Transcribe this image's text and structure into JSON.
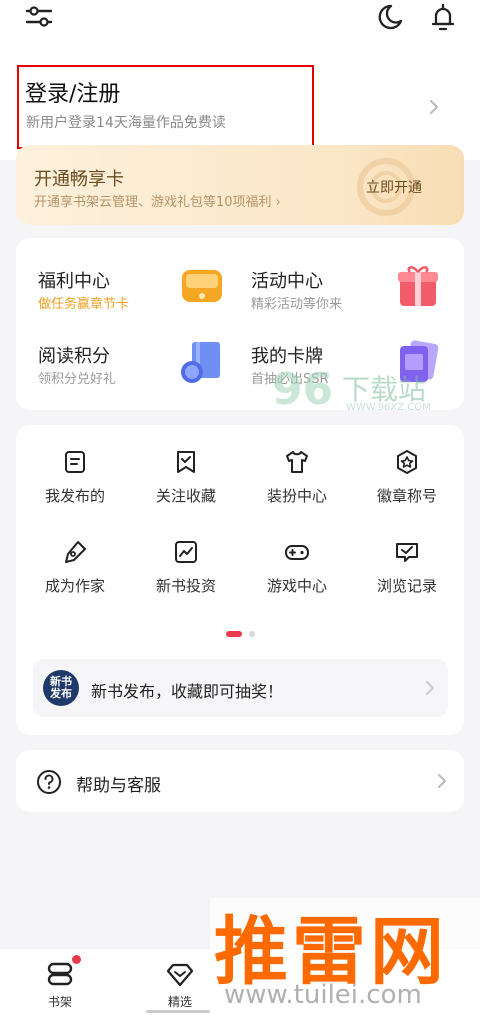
{
  "header": {
    "login_title": "登录/注册",
    "login_subtitle": "新用户登录14天海量作品免费读"
  },
  "vip": {
    "title": "开通畅享卡",
    "subtitle": "开通享书架云管理、游戏礼包等10项福利 ›",
    "cta": "立即开通"
  },
  "benefits": [
    {
      "title": "福利中心",
      "subtitle": "做任务赢章节卡",
      "icon": "coin-box-icon"
    },
    {
      "title": "活动中心",
      "subtitle": "精彩活动等你来",
      "icon": "gift-box-icon"
    },
    {
      "title": "阅读积分",
      "subtitle": "领积分兑好礼",
      "icon": "book-coin-icon"
    },
    {
      "title": "我的卡牌",
      "subtitle": "首抽必出SSR",
      "icon": "card-icon"
    }
  ],
  "grid": [
    {
      "label": "我发布的",
      "icon": "document-icon"
    },
    {
      "label": "关注收藏",
      "icon": "bookmark-check-icon"
    },
    {
      "label": "装扮中心",
      "icon": "shirt-icon"
    },
    {
      "label": "徽章称号",
      "icon": "badge-star-icon"
    },
    {
      "label": "成为作家",
      "icon": "pen-nib-icon"
    },
    {
      "label": "新书投资",
      "icon": "trend-chart-icon"
    },
    {
      "label": "游戏中心",
      "icon": "gamepad-icon"
    },
    {
      "label": "浏览记录",
      "icon": "history-check-icon"
    }
  ],
  "promo": {
    "badge": "新书\n发布",
    "text": "新书发布，收藏即可抽奖！"
  },
  "help": {
    "label": "帮助与客服"
  },
  "bottom_nav": [
    {
      "label": "书架",
      "icon": "bookshelf-icon"
    },
    {
      "label": "精选",
      "icon": "diamond-icon"
    }
  ],
  "watermarks": {
    "site96_logo": "96",
    "site96_name": "下载站",
    "site96_url": "WWW.96XZ.COM",
    "tuilei_name": "推雷网",
    "tuilei_url": "www.tuilei.com"
  },
  "colors": {
    "accent_red": "#e83a4d",
    "highlight_box": "#e60000",
    "vip_text": "#6b4a1e",
    "orange_text": "#f0a020"
  }
}
